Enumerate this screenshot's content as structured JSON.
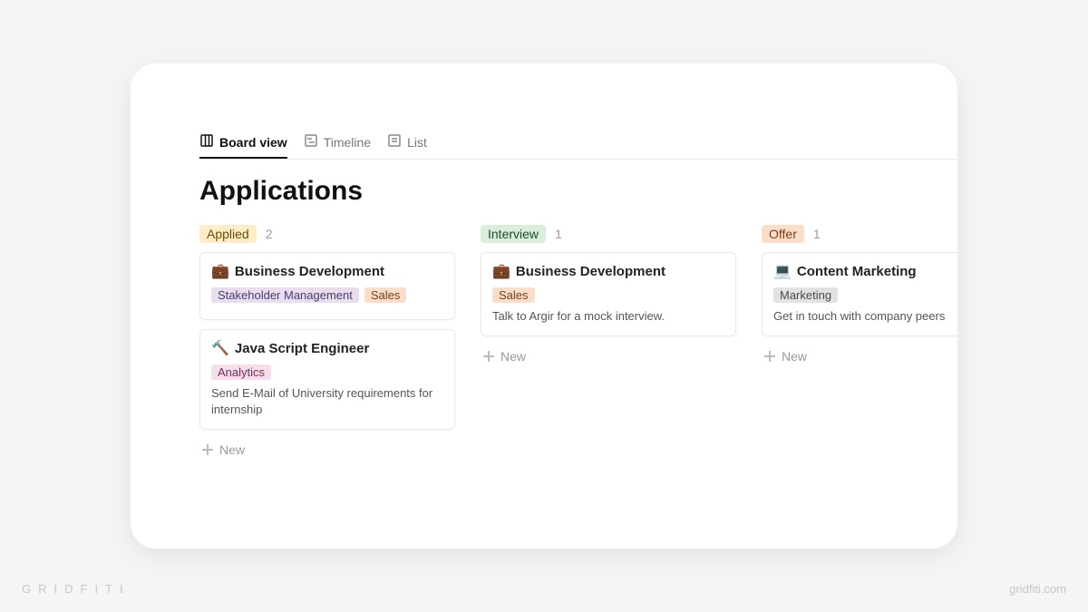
{
  "tabs": [
    {
      "label": "Board view",
      "active": true,
      "icon": "board-icon"
    },
    {
      "label": "Timeline",
      "active": false,
      "icon": "timeline-icon"
    },
    {
      "label": "List",
      "active": false,
      "icon": "list-icon"
    }
  ],
  "page_title": "Applications",
  "new_label": "New",
  "columns": [
    {
      "name": "Applied",
      "count": "2",
      "badge_bg": "#fdecc8",
      "badge_fg": "#6b4e00",
      "cards": [
        {
          "emoji": "💼",
          "title": "Business Development",
          "tags": [
            {
              "text": "Stakeholder Management",
              "bg": "#e8deee",
              "fg": "#4b3a78"
            },
            {
              "text": "Sales",
              "bg": "#fadec9",
              "fg": "#7a3e16"
            }
          ],
          "note": ""
        },
        {
          "emoji": "🔨",
          "title": "Java Script Engineer",
          "tags": [
            {
              "text": "Analytics",
              "bg": "#f5dfeb",
              "fg": "#7a2a57"
            }
          ],
          "note": "Send E-Mail of University requirements for internship"
        }
      ]
    },
    {
      "name": "Interview",
      "count": "1",
      "badge_bg": "#dbeddb",
      "badge_fg": "#1c4a2b",
      "cards": [
        {
          "emoji": "💼",
          "title": "Business Development",
          "tags": [
            {
              "text": "Sales",
              "bg": "#fadec9",
              "fg": "#7a3e16"
            }
          ],
          "note": "Talk to Argir for a mock interview."
        }
      ]
    },
    {
      "name": "Offer",
      "count": "1",
      "badge_bg": "#fadec9",
      "badge_fg": "#7a3e16",
      "cards": [
        {
          "emoji": "💻",
          "title": "Content Marketing",
          "tags": [
            {
              "text": "Marketing",
              "bg": "#e3e2e0",
              "fg": "#4a4a4a"
            }
          ],
          "note": "Get in touch with company peers"
        }
      ]
    }
  ],
  "brand_left": "GRIDFITI",
  "brand_right": "gridfiti.com"
}
